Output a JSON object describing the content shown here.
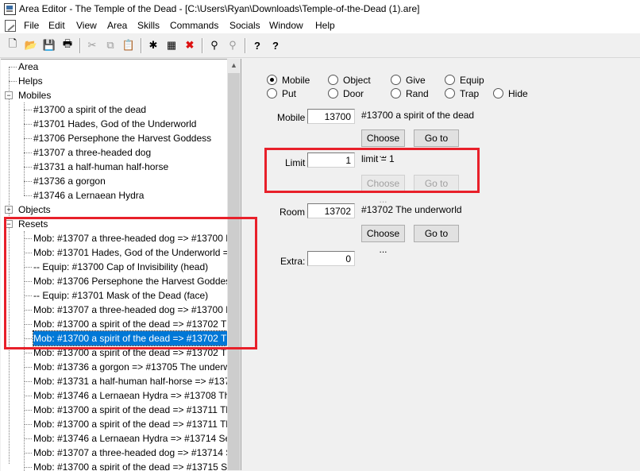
{
  "window": {
    "title": "Area Editor - The Temple of the Dead - [C:\\Users\\Ryan\\Downloads\\Temple-of-the-Dead (1).are]"
  },
  "menu": [
    "File",
    "Edit",
    "View",
    "Area",
    "Skills",
    "Commands",
    "Socials",
    "Window",
    "Help"
  ],
  "toolbar": {
    "icons": [
      "new-file-icon",
      "open-folder-icon",
      "save-icon",
      "print-icon",
      "cut-icon",
      "copy-icon",
      "paste-icon",
      "add-item-icon",
      "edit-item-icon",
      "delete-icon",
      "find-icon",
      "find-next-icon",
      "help-icon",
      "context-help-icon"
    ],
    "glyphs": [
      "🗋",
      "📂",
      "💾",
      "🖶",
      "✂",
      "⧉",
      "📋",
      "✱",
      "▦",
      "✖",
      "⚲",
      "⚲",
      "?",
      "?"
    ],
    "delete_color": "#d11"
  },
  "tree": {
    "area": "Area",
    "helps": "Helps",
    "mobiles": "Mobiles",
    "mobile_items": [
      "#13700 a spirit of the dead",
      "#13701 Hades, God of the Underworld",
      "#13706 Persephone the Harvest Goddess",
      "#13707 a three-headed dog",
      "#13731 a half-human half-horse",
      "#13736 a gorgon",
      "#13746 a Lernaean Hydra"
    ],
    "objects": "Objects",
    "resets": "Resets",
    "reset_items": [
      "Mob: #13707 a three-headed dog => #13700 E",
      "Mob: #13701 Hades, God of the Underworld =",
      "-- Equip: #13700 Cap of Invisibility (head)",
      "Mob: #13706 Persephone the Harvest Goddess",
      "-- Equip: #13701 Mask of the Dead (face)",
      "Mob: #13707 a three-headed dog => #13700 E",
      "Mob: #13700 a spirit of the dead => #13702 Th",
      "Mob: #13700 a spirit of the dead => #13702 Th",
      "Mob: #13700 a spirit of the dead => #13702 Th",
      "Mob: #13736 a gorgon => #13705 The underw",
      "Mob: #13731 a half-human half-horse => #137",
      "Mob: #13746 a Lernaean Hydra => #13708 The",
      "Mob: #13700 a spirit of the dead => #13711 Th",
      "Mob: #13700 a spirit of the dead => #13711 Th",
      "Mob: #13746 a Lernaean Hydra => #13714 Sec",
      "Mob: #13707 a three-headed dog => #13714 S",
      "Mob: #13700 a spirit of the dead => #13715 Se"
    ],
    "selected_reset_index": 7
  },
  "editor": {
    "radios": [
      "Mobile",
      "Object",
      "Give",
      "Equip",
      "Put",
      "Door",
      "Rand",
      "Trap",
      "Hide"
    ],
    "selected_radio": "Mobile",
    "mobile": {
      "label": "Mobile",
      "value": "13700",
      "desc": "#13700 a spirit of the dead",
      "choose": "Choose ...",
      "goto": "Go to"
    },
    "limit": {
      "label": "Limit",
      "value": "1",
      "desc": "limit = 1",
      "choose": "Choose ...",
      "goto": "Go to"
    },
    "room": {
      "label": "Room",
      "value": "13702",
      "desc": "#13702 The underworld",
      "choose": "Choose ...",
      "goto": "Go to"
    },
    "extra": {
      "label": "Extra:",
      "value": "0"
    }
  },
  "highlight_color": "#e8202a",
  "selection_color": "#0078d7"
}
